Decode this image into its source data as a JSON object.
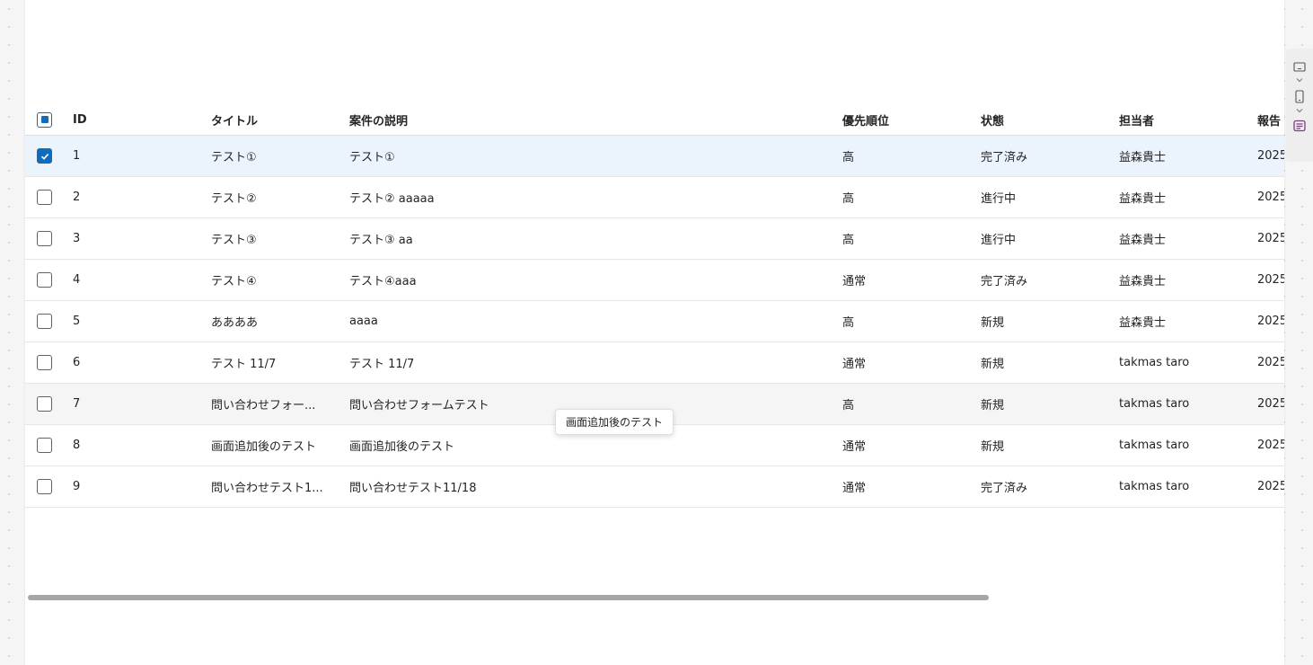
{
  "columns": {
    "id": "ID",
    "title": "タイトル",
    "description": "案件の説明",
    "priority": "優先順位",
    "status": "状態",
    "owner": "担当者",
    "report": "報告"
  },
  "rows": [
    {
      "id": "1",
      "title": "テスト①",
      "description": "テスト①",
      "priority": "高",
      "status": "完了済み",
      "owner": "益森貴士",
      "report": "2025"
    },
    {
      "id": "2",
      "title": "テスト②",
      "description": "テスト② aaaaa",
      "priority": "高",
      "status": "進行中",
      "owner": "益森貴士",
      "report": "2025"
    },
    {
      "id": "3",
      "title": "テスト③",
      "description": "テスト③ aa",
      "priority": "高",
      "status": "進行中",
      "owner": "益森貴士",
      "report": "2025"
    },
    {
      "id": "4",
      "title": "テスト④",
      "description": "テスト④aaa",
      "priority": "通常",
      "status": "完了済み",
      "owner": "益森貴士",
      "report": "2025"
    },
    {
      "id": "5",
      "title": "ああああ",
      "description": "aaaa",
      "priority": "高",
      "status": "新規",
      "owner": "益森貴士",
      "report": "2025"
    },
    {
      "id": "6",
      "title": "テスト 11/7",
      "description": "テスト 11/7",
      "priority": "通常",
      "status": "新規",
      "owner": "takmas taro",
      "report": "2025"
    },
    {
      "id": "7",
      "title": "問い合わせフォー...",
      "description": "問い合わせフォームテスト",
      "priority": "高",
      "status": "新規",
      "owner": "takmas taro",
      "report": "2025"
    },
    {
      "id": "8",
      "title": "画面追加後のテスト",
      "description": "画面追加後のテスト",
      "priority": "通常",
      "status": "新規",
      "owner": "takmas taro",
      "report": "2025"
    },
    {
      "id": "9",
      "title": "問い合わせテスト1...",
      "description": "問い合わせテスト11/18",
      "priority": "通常",
      "status": "完了済み",
      "owner": "takmas taro",
      "report": "2025"
    }
  ],
  "tooltip": "画面追加後のテスト",
  "side_rail_icons": [
    "desktop-icon",
    "phone-icon",
    "form-icon"
  ],
  "colors": {
    "accent": "#0f6cbd",
    "selected_row": "#ebf3fc",
    "form_icon": "#7a3b7a"
  }
}
